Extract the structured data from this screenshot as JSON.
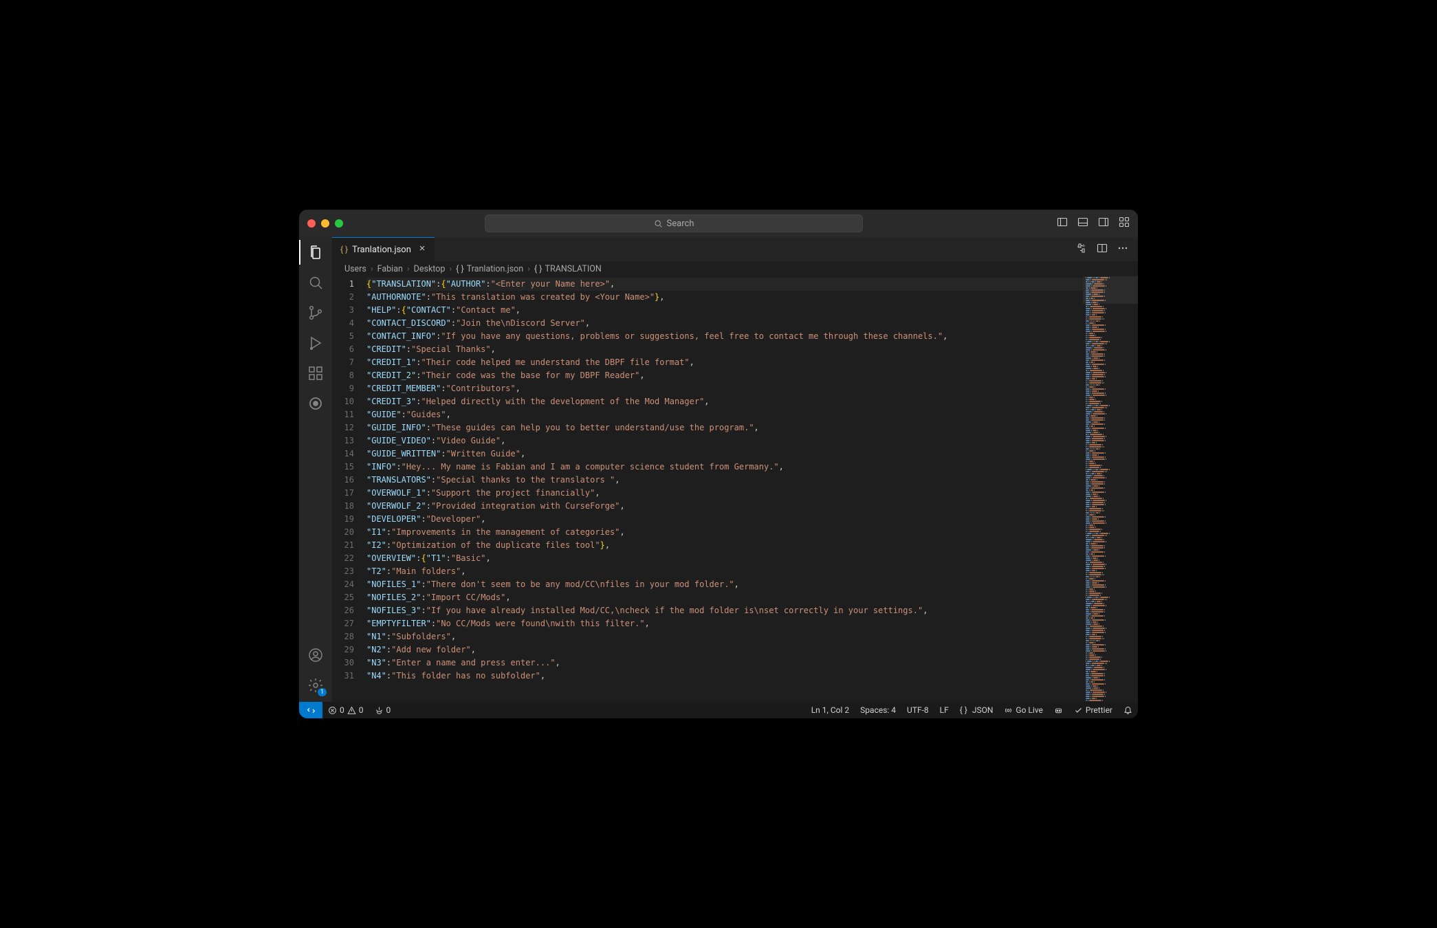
{
  "titlebar": {
    "search_placeholder": "Search"
  },
  "tab": {
    "filename": "Tranlation.json"
  },
  "breadcrumbs": {
    "items": [
      "Users",
      "Fabian",
      "Desktop",
      "Tranlation.json",
      "TRANSLATION"
    ]
  },
  "activity": {
    "gear_badge": "1"
  },
  "code_lines": [
    [
      [
        "p",
        "{"
      ],
      [
        "k",
        "\"TRANSLATION\""
      ],
      [
        "c",
        ":"
      ],
      [
        "p",
        "{"
      ],
      [
        "k",
        "\"AUTHOR\""
      ],
      [
        "c",
        ":"
      ],
      [
        "s",
        "\"<Enter your Name here>\""
      ],
      [
        "c",
        ","
      ]
    ],
    [
      [
        "k",
        "\"AUTHORNOTE\""
      ],
      [
        "c",
        ":"
      ],
      [
        "s",
        "\"This translation was created by <Your Name>\""
      ],
      [
        "p",
        "}"
      ],
      [
        "c",
        ","
      ]
    ],
    [
      [
        "k",
        "\"HELP\""
      ],
      [
        "c",
        ":"
      ],
      [
        "p",
        "{"
      ],
      [
        "k",
        "\"CONTACT\""
      ],
      [
        "c",
        ":"
      ],
      [
        "s",
        "\"Contact me\""
      ],
      [
        "c",
        ","
      ]
    ],
    [
      [
        "k",
        "\"CONTACT_DISCORD\""
      ],
      [
        "c",
        ":"
      ],
      [
        "s",
        "\"Join the\\nDiscord Server\""
      ],
      [
        "c",
        ","
      ]
    ],
    [
      [
        "k",
        "\"CONTACT_INFO\""
      ],
      [
        "c",
        ":"
      ],
      [
        "s",
        "\"If you have any questions, problems or suggestions, feel free to contact me through these channels.\""
      ],
      [
        "c",
        ","
      ]
    ],
    [
      [
        "k",
        "\"CREDIT\""
      ],
      [
        "c",
        ":"
      ],
      [
        "s",
        "\"Special Thanks\""
      ],
      [
        "c",
        ","
      ]
    ],
    [
      [
        "k",
        "\"CREDIT_1\""
      ],
      [
        "c",
        ":"
      ],
      [
        "s",
        "\"Their code helped me understand the DBPF file format\""
      ],
      [
        "c",
        ","
      ]
    ],
    [
      [
        "k",
        "\"CREDIT_2\""
      ],
      [
        "c",
        ":"
      ],
      [
        "s",
        "\"Their code was the base for my DBPF Reader\""
      ],
      [
        "c",
        ","
      ]
    ],
    [
      [
        "k",
        "\"CREDIT_MEMBER\""
      ],
      [
        "c",
        ":"
      ],
      [
        "s",
        "\"Contributors\""
      ],
      [
        "c",
        ","
      ]
    ],
    [
      [
        "k",
        "\"CREDIT_3\""
      ],
      [
        "c",
        ":"
      ],
      [
        "s",
        "\"Helped directly with the development of the Mod Manager\""
      ],
      [
        "c",
        ","
      ]
    ],
    [
      [
        "k",
        "\"GUIDE\""
      ],
      [
        "c",
        ":"
      ],
      [
        "s",
        "\"Guides\""
      ],
      [
        "c",
        ","
      ]
    ],
    [
      [
        "k",
        "\"GUIDE_INFO\""
      ],
      [
        "c",
        ":"
      ],
      [
        "s",
        "\"These guides can help you to better understand/use the program.\""
      ],
      [
        "c",
        ","
      ]
    ],
    [
      [
        "k",
        "\"GUIDE_VIDEO\""
      ],
      [
        "c",
        ":"
      ],
      [
        "s",
        "\"Video Guide\""
      ],
      [
        "c",
        ","
      ]
    ],
    [
      [
        "k",
        "\"GUIDE_WRITTEN\""
      ],
      [
        "c",
        ":"
      ],
      [
        "s",
        "\"Written Guide\""
      ],
      [
        "c",
        ","
      ]
    ],
    [
      [
        "k",
        "\"INFO\""
      ],
      [
        "c",
        ":"
      ],
      [
        "s",
        "\"Hey... My name is Fabian and I am a computer science student from Germany.\""
      ],
      [
        "c",
        ","
      ]
    ],
    [
      [
        "k",
        "\"TRANSLATORS\""
      ],
      [
        "c",
        ":"
      ],
      [
        "s",
        "\"Special thanks to the translators \""
      ],
      [
        "c",
        ","
      ]
    ],
    [
      [
        "k",
        "\"OVERWOLF_1\""
      ],
      [
        "c",
        ":"
      ],
      [
        "s",
        "\"Support the project financially\""
      ],
      [
        "c",
        ","
      ]
    ],
    [
      [
        "k",
        "\"OVERWOLF_2\""
      ],
      [
        "c",
        ":"
      ],
      [
        "s",
        "\"Provided integration with CurseForge\""
      ],
      [
        "c",
        ","
      ]
    ],
    [
      [
        "k",
        "\"DEVELOPER\""
      ],
      [
        "c",
        ":"
      ],
      [
        "s",
        "\"Developer\""
      ],
      [
        "c",
        ","
      ]
    ],
    [
      [
        "k",
        "\"I1\""
      ],
      [
        "c",
        ":"
      ],
      [
        "s",
        "\"Improvements in the management of categories\""
      ],
      [
        "c",
        ","
      ]
    ],
    [
      [
        "k",
        "\"I2\""
      ],
      [
        "c",
        ":"
      ],
      [
        "s",
        "\"Optimization of the duplicate files tool\""
      ],
      [
        "p",
        "}"
      ],
      [
        "c",
        ","
      ]
    ],
    [
      [
        "k",
        "\"OVERVIEW\""
      ],
      [
        "c",
        ":"
      ],
      [
        "p",
        "{"
      ],
      [
        "k",
        "\"T1\""
      ],
      [
        "c",
        ":"
      ],
      [
        "s",
        "\"Basic\""
      ],
      [
        "c",
        ","
      ]
    ],
    [
      [
        "k",
        "\"T2\""
      ],
      [
        "c",
        ":"
      ],
      [
        "s",
        "\"Main folders\""
      ],
      [
        "c",
        ","
      ]
    ],
    [
      [
        "k",
        "\"NOFILES_1\""
      ],
      [
        "c",
        ":"
      ],
      [
        "s",
        "\"There don't seem to be any mod/CC\\nfiles in your mod folder.\""
      ],
      [
        "c",
        ","
      ]
    ],
    [
      [
        "k",
        "\"NOFILES_2\""
      ],
      [
        "c",
        ":"
      ],
      [
        "s",
        "\"Import CC/Mods\""
      ],
      [
        "c",
        ","
      ]
    ],
    [
      [
        "k",
        "\"NOFILES_3\""
      ],
      [
        "c",
        ":"
      ],
      [
        "s",
        "\"If you have already installed Mod/CC,\\ncheck if the mod folder is\\nset correctly in your settings.\""
      ],
      [
        "c",
        ","
      ]
    ],
    [
      [
        "k",
        "\"EMPTYFILTER\""
      ],
      [
        "c",
        ":"
      ],
      [
        "s",
        "\"No CC/Mods were found\\nwith this filter.\""
      ],
      [
        "c",
        ","
      ]
    ],
    [
      [
        "k",
        "\"N1\""
      ],
      [
        "c",
        ":"
      ],
      [
        "s",
        "\"Subfolders\""
      ],
      [
        "c",
        ","
      ]
    ],
    [
      [
        "k",
        "\"N2\""
      ],
      [
        "c",
        ":"
      ],
      [
        "s",
        "\"Add new folder\""
      ],
      [
        "c",
        ","
      ]
    ],
    [
      [
        "k",
        "\"N3\""
      ],
      [
        "c",
        ":"
      ],
      [
        "s",
        "\"Enter a name and press enter...\""
      ],
      [
        "c",
        ","
      ]
    ],
    [
      [
        "k",
        "\"N4\""
      ],
      [
        "c",
        ":"
      ],
      [
        "s",
        "\"This folder has no subfolder\""
      ],
      [
        "c",
        ","
      ]
    ]
  ],
  "status": {
    "errors": "0",
    "warnings": "0",
    "port": "0",
    "ln_col": "Ln 1, Col 2",
    "spaces": "Spaces: 4",
    "encoding": "UTF-8",
    "eol": "LF",
    "language": "JSON",
    "golive": "Go Live",
    "prettier": "Prettier"
  }
}
